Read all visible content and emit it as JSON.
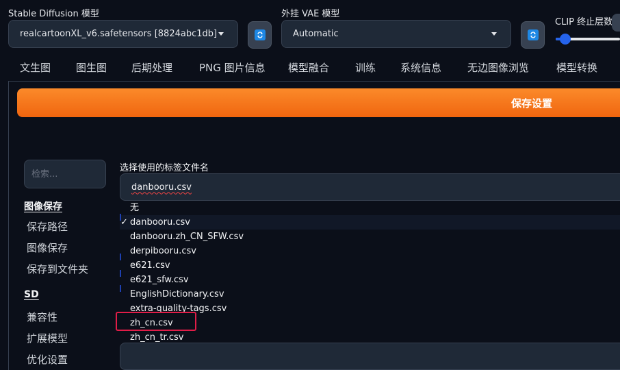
{
  "top": {
    "model_label": "Stable Diffusion 模型",
    "model_value": "realcartoonXL_v6.safetensors [8824abc1db]",
    "vae_label": "外挂 VAE 模型",
    "vae_value": "Automatic",
    "clip_label": "CLIP 终止层数"
  },
  "tabs": [
    "文生图",
    "图生图",
    "后期处理",
    "PNG 图片信息",
    "模型融合",
    "训练",
    "系统信息",
    "无边图像浏览",
    "模型转换"
  ],
  "save_button": "保存设置",
  "sidebar": {
    "search_placeholder": "检索...",
    "sections": [
      {
        "title": "图像保存",
        "items": [
          "保存路径",
          "图像保存",
          "保存到文件夹"
        ]
      },
      {
        "title": "SD",
        "items": [
          "兼容性",
          "扩展模型",
          "优化设置"
        ]
      }
    ]
  },
  "field": {
    "label": "选择使用的标签文件名",
    "value": "danbooru.csv"
  },
  "dropdown": {
    "check_glyph": "✓",
    "options": [
      "无",
      "danbooru.csv",
      "danbooru.zh_CN_SFW.csv",
      "derpibooru.csv",
      "e621.csv",
      "e621_sfw.csv",
      "EnglishDictionary.csv",
      "extra-quality-tags.csv",
      "zh_cn.csv",
      "zh_cn_tr.csv"
    ]
  },
  "colors": {
    "accent_orange": "#f97316",
    "highlight_red": "#e11d48",
    "slider_blue": "#2563eb"
  }
}
